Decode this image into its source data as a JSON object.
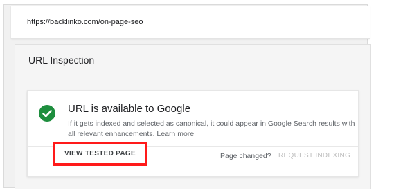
{
  "url_bar": {
    "url": "https://backlinko.com/on-page-seo"
  },
  "panel": {
    "title": "URL Inspection"
  },
  "result": {
    "title": "URL is available to Google",
    "description": "If it gets indexed and selected as canonical, it could appear in Google Search results with all relevant enhancements.",
    "learn_more": "Learn more",
    "status_icon": "check-circle-icon",
    "status_color": "#1e8e3e"
  },
  "actions": {
    "view_tested": "VIEW TESTED PAGE",
    "page_changed": "Page changed?",
    "request_indexing": "REQUEST INDEXING"
  },
  "colors": {
    "highlight_border": "#ff1a1a"
  }
}
